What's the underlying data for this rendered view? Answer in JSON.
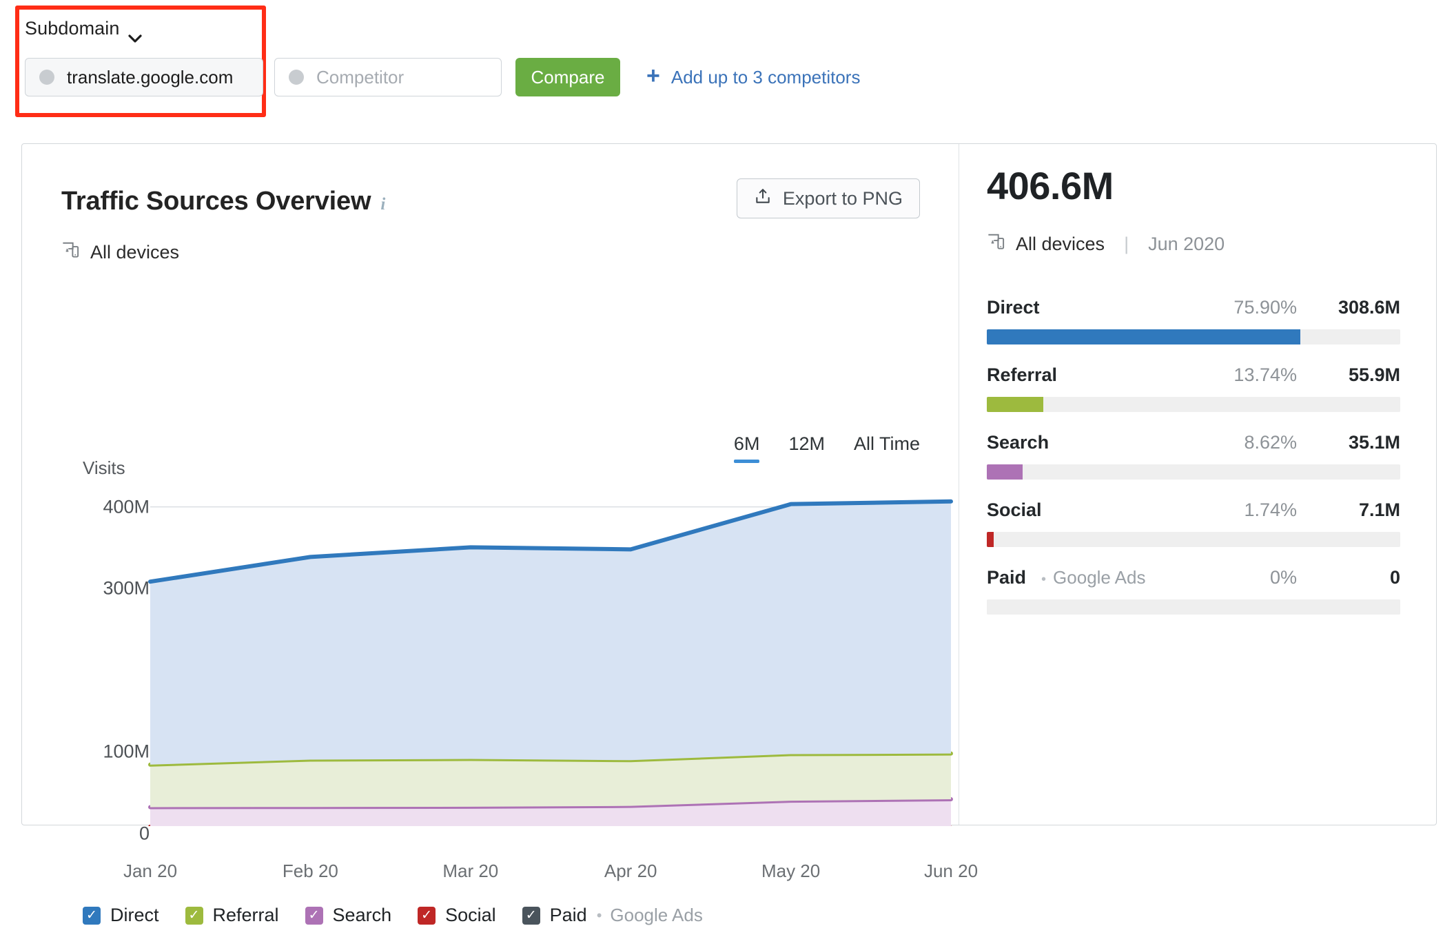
{
  "topbar": {
    "subdomain_label": "Subdomain",
    "chevron_icon": "chevron-down-icon",
    "domain_value": "translate.google.com",
    "competitor_placeholder": "Competitor",
    "compare_label": "Compare",
    "add_competitors_label": "Add up to 3 competitors",
    "plus_icon": "+"
  },
  "chart_panel": {
    "title": "Traffic Sources Overview",
    "info_icon": "i",
    "export_label": "Export to PNG",
    "export_icon": "upload-icon",
    "devices_label": "All devices",
    "devices_icon": "all-devices-icon",
    "periods": [
      {
        "label": "6M",
        "active": true
      },
      {
        "label": "12M",
        "active": false
      },
      {
        "label": "All Time",
        "active": false
      }
    ],
    "legend": [
      {
        "label": "Direct",
        "color": "#3079bd",
        "checked": true
      },
      {
        "label": "Referral",
        "color": "#9dba3e",
        "checked": true
      },
      {
        "label": "Search",
        "color": "#ad72b5",
        "checked": true
      },
      {
        "label": "Social",
        "color": "#bf2726",
        "checked": true
      },
      {
        "label": "Paid",
        "color": "#4a545c",
        "checked": true,
        "sub": "Google Ads",
        "sub_dot": "•"
      }
    ]
  },
  "chart_data": {
    "type": "area",
    "stacked": true,
    "title": "Traffic Sources Overview",
    "xlabel": "",
    "ylabel": "Visits",
    "ylim": [
      0,
      420
    ],
    "yticks": [
      0,
      100,
      300,
      400
    ],
    "ytick_labels": [
      "0",
      "100M",
      "300M",
      "400M"
    ],
    "grid": true,
    "legend_position": "bottom",
    "unit": "M visits",
    "categories": [
      "Jan 20",
      "Feb 20",
      "Mar 20",
      "Apr 20",
      "May 20",
      "Jun 20"
    ],
    "series": [
      {
        "name": "Paid",
        "color": "#4a545c",
        "fill": "#ffffff",
        "values": [
          1.0,
          1.0,
          1.0,
          1.0,
          1.0,
          0.0
        ]
      },
      {
        "name": "Social",
        "color": "#bf2726",
        "fill": "#f7e3e3",
        "values": [
          7.5,
          7.2,
          7.0,
          7.0,
          7.4,
          7.1
        ]
      },
      {
        "name": "Search",
        "color": "#ad72b5",
        "fill": "#eedff0",
        "values": [
          24.0,
          24.5,
          25.0,
          26.0,
          32.0,
          35.1
        ]
      },
      {
        "name": "Referral",
        "color": "#9dba3e",
        "fill": "#e8eed8",
        "values": [
          52.0,
          58.0,
          58.5,
          56.0,
          57.0,
          55.9
        ]
      },
      {
        "name": "Direct",
        "color": "#3079bd",
        "fill": "#d7e3f3",
        "values": [
          224.0,
          248.0,
          259.0,
          258.0,
          306.0,
          308.6
        ]
      }
    ],
    "totals": [
      308.5,
      338.7,
      350.5,
      348.0,
      403.4,
      406.7
    ]
  },
  "summary_panel": {
    "total": "406.6M",
    "devices_label": "All devices",
    "devices_icon": "all-devices-icon",
    "separator": "|",
    "date": "Jun 2020",
    "sources": [
      {
        "name": "Direct",
        "percent": "75.90%",
        "value": "308.6M",
        "bar_pct": 75.9,
        "color": "#3079bd"
      },
      {
        "name": "Referral",
        "percent": "13.74%",
        "value": "55.9M",
        "bar_pct": 13.74,
        "color": "#9dba3e"
      },
      {
        "name": "Search",
        "percent": "8.62%",
        "value": "35.1M",
        "bar_pct": 8.62,
        "color": "#ad72b5"
      },
      {
        "name": "Social",
        "percent": "1.74%",
        "value": "7.1M",
        "bar_pct": 1.74,
        "color": "#bf2726"
      },
      {
        "name": "Paid",
        "sub": "Google Ads",
        "sub_dot": "•",
        "percent": "0%",
        "value": "0",
        "bar_pct": 0,
        "color": "#4a545c"
      }
    ]
  }
}
